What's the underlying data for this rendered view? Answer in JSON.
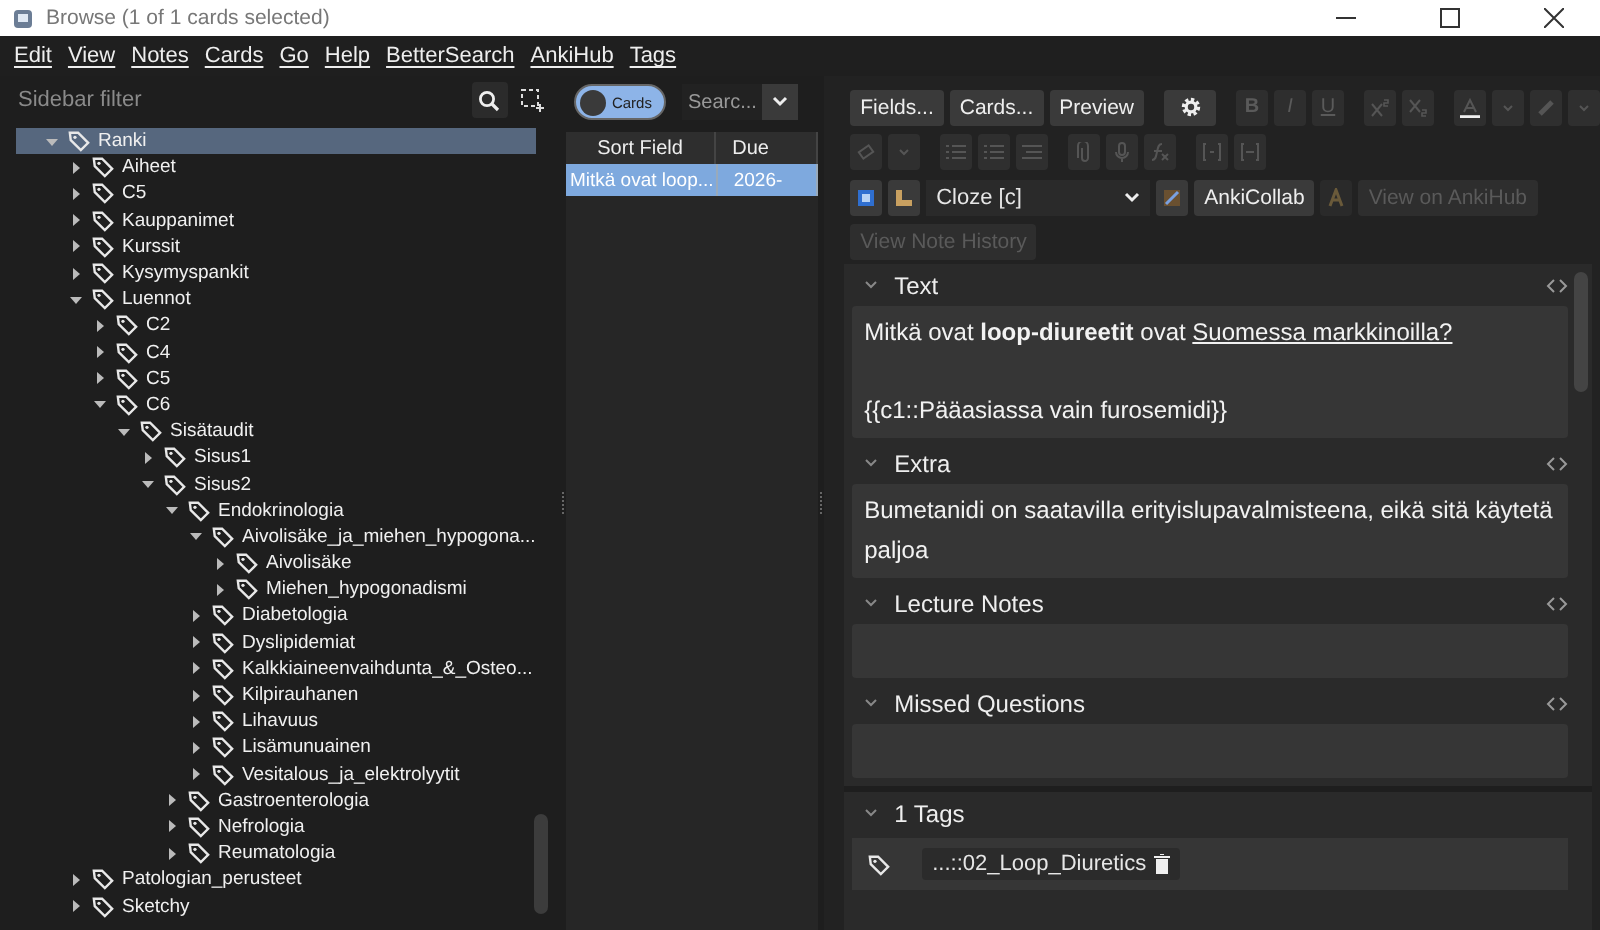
{
  "window": {
    "title": "Browse (1 of 1 cards selected)"
  },
  "menu": [
    "Edit",
    "View",
    "Notes",
    "Cards",
    "Go",
    "Help",
    "BetterSearch",
    "AnkiHub",
    "Tags"
  ],
  "sidebar": {
    "filter_placeholder": "Sidebar filter",
    "tree": [
      {
        "label": "Ranki",
        "expanded": true,
        "selected": true,
        "children": [
          {
            "label": "Aiheet",
            "expanded": false,
            "selected": false
          },
          {
            "label": "C5",
            "expanded": false,
            "selected": false
          },
          {
            "label": "Kauppanimet",
            "expanded": false,
            "selected": false
          },
          {
            "label": "Kurssit",
            "expanded": false,
            "selected": false
          },
          {
            "label": "Kysymyspankit",
            "expanded": false,
            "selected": false
          },
          {
            "label": "Luennot",
            "expanded": true,
            "selected": false,
            "children": [
              {
                "label": "C2",
                "expanded": false,
                "selected": false
              },
              {
                "label": "C4",
                "expanded": false,
                "selected": false
              },
              {
                "label": "C5",
                "expanded": false,
                "selected": false
              },
              {
                "label": "C6",
                "expanded": true,
                "selected": false,
                "children": [
                  {
                    "label": "Sisätaudit",
                    "expanded": true,
                    "selected": false,
                    "children": [
                      {
                        "label": "Sisus1",
                        "expanded": false,
                        "selected": false
                      },
                      {
                        "label": "Sisus2",
                        "expanded": true,
                        "selected": false,
                        "children": [
                          {
                            "label": "Endokrinologia",
                            "expanded": true,
                            "selected": false,
                            "children": [
                              {
                                "label": "Aivolisäke_ja_miehen_hypogona...",
                                "expanded": true,
                                "selected": false,
                                "children": [
                                  {
                                    "label": "Aivolisäke",
                                    "expanded": false,
                                    "selected": false
                                  },
                                  {
                                    "label": "Miehen_hypogonadismi",
                                    "expanded": false,
                                    "selected": false
                                  }
                                ]
                              },
                              {
                                "label": "Diabetologia",
                                "expanded": false,
                                "selected": false
                              },
                              {
                                "label": "Dyslipidemiat",
                                "expanded": false,
                                "selected": false
                              },
                              {
                                "label": "Kalkkiaineenvaihdunta_&_Osteo...",
                                "expanded": false,
                                "selected": false
                              },
                              {
                                "label": "Kilpirauhanen",
                                "expanded": false,
                                "selected": false
                              },
                              {
                                "label": "Lihavuus",
                                "expanded": false,
                                "selected": false
                              },
                              {
                                "label": "Lisämunuainen",
                                "expanded": false,
                                "selected": false
                              },
                              {
                                "label": "Vesitalous_ja_elektrolyytit",
                                "expanded": false,
                                "selected": false
                              }
                            ]
                          },
                          {
                            "label": "Gastroenterologia",
                            "expanded": false,
                            "selected": false
                          },
                          {
                            "label": "Nefrologia",
                            "expanded": false,
                            "selected": false
                          },
                          {
                            "label": "Reumatologia",
                            "expanded": false,
                            "selected": false
                          }
                        ]
                      }
                    ]
                  }
                ]
              }
            ]
          },
          {
            "label": "Patologian_perusteet",
            "expanded": false,
            "selected": false
          },
          {
            "label": "Sketchy",
            "expanded": false,
            "selected": false
          }
        ]
      }
    ]
  },
  "browser": {
    "toggle": {
      "label": "Cards"
    },
    "search_placeholder": "Searc...",
    "columns": [
      "Sort Field",
      "Due"
    ],
    "rows": [
      {
        "cells": [
          "Mitkä ovat loop...",
          "2026-"
        ],
        "selected": true
      }
    ]
  },
  "editor": {
    "buttons": [
      "Fields...",
      "Cards...",
      "Preview"
    ],
    "format_buttons": [
      {
        "label": "B",
        "disabled": true
      },
      {
        "label": "I",
        "disabled": true
      },
      {
        "label": "U",
        "disabled": true
      }
    ],
    "notetype": "Cloze [c]",
    "addon_buttons": [
      {
        "label": "AnkiCollab",
        "disabled": false
      },
      {
        "label": "View on AnkiHub",
        "disabled": true
      }
    ],
    "history_button": {
      "label": "View Note History",
      "disabled": true
    },
    "fields": [
      {
        "name": "Text",
        "expanded": true,
        "paragraphs": [
          [
            {
              "text": "Mitkä ovat "
            },
            {
              "text": "loop-diureetit",
              "bold": true
            },
            {
              "text": " ovat "
            },
            {
              "text": "Suomessa markkinoilla?",
              "underline": true
            }
          ],
          [
            {
              "text": "{{c1::Pääasiassa vain furosemidi}}"
            }
          ]
        ]
      },
      {
        "name": "Extra",
        "expanded": true,
        "paragraphs": [
          [
            {
              "text": "Bumetanidi on saatavilla erityislupavalmisteena, eikä sitä käytetä paljoa"
            }
          ]
        ]
      },
      {
        "name": "Lecture Notes",
        "expanded": true
      },
      {
        "name": "Missed Questions",
        "expanded": true
      }
    ],
    "tags_header": "1 Tags",
    "tags": [
      "...::02_Loop_Diuretics"
    ]
  }
}
